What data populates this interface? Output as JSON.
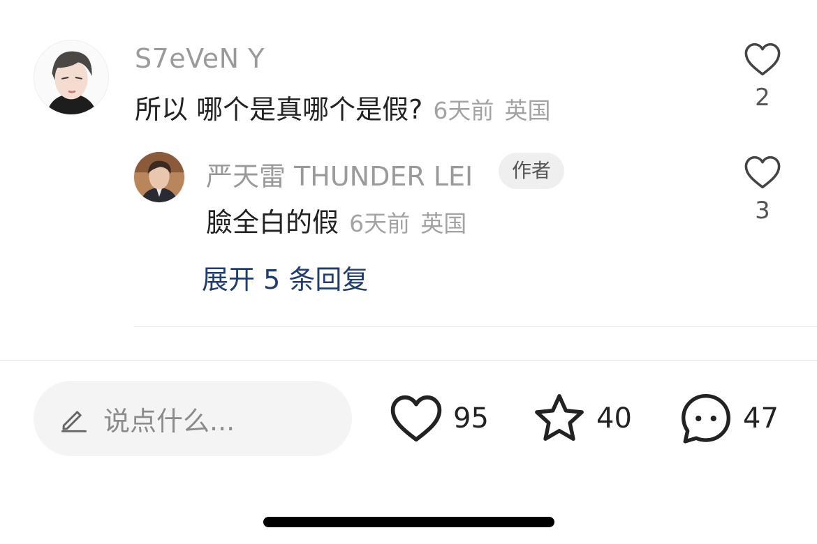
{
  "comment": {
    "username": "S7eVeN Y",
    "text": "所以 哪个是真哪个是假?",
    "time": "6天前",
    "location": "英国",
    "likes": "2"
  },
  "reply": {
    "username": "严天雷 THUNDER LEI",
    "badge": "作者",
    "text": "臉全白的假",
    "time": "6天前",
    "location": "英国",
    "likes": "3"
  },
  "expand_label": "展开 5 条回复",
  "bottom_bar": {
    "input_placeholder": "说点什么...",
    "likes": "95",
    "favorites": "40",
    "comments": "47"
  }
}
